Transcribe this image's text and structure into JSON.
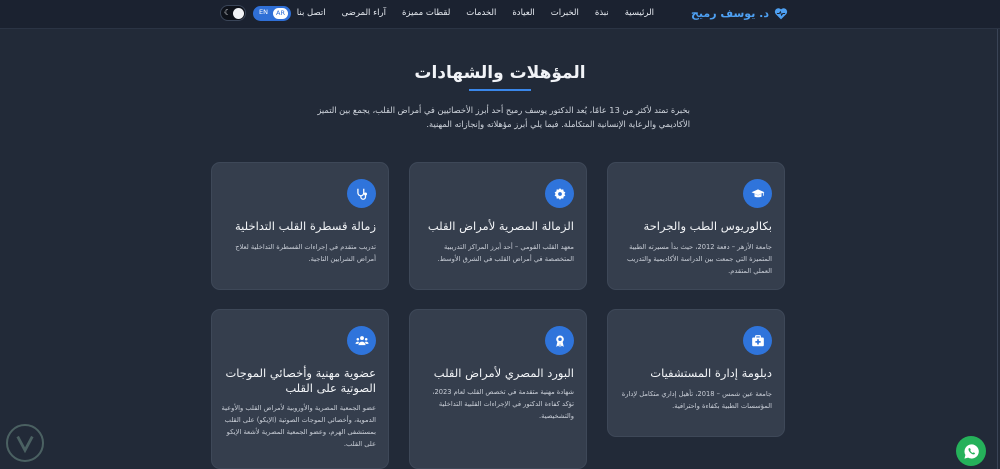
{
  "navbar": {
    "brand": "د. يوسف رميح",
    "links": [
      "الرئيسية",
      "نبذة",
      "الخبرات",
      "العيادة",
      "الخدمات",
      "لقطات مميزة",
      "آراء المرضى",
      "اتصل بنا"
    ],
    "lang_en": "EN",
    "lang_ar": "AR",
    "accent_color": "#4ea0f2"
  },
  "section": {
    "title": "المؤهلات والشهادات",
    "description": "بخبرة تمتد لأكثر من 13 عامًا، يُعد الدكتور يوسف رميح أحد أبرز الأخصائيين في أمراض القلب، يجمع بين التميز الأكاديمي والرعاية الإنسانية المتكاملة. فيما يلي أبرز مؤهلاته وإنجازاته المهنية."
  },
  "cards": [
    {
      "icon": "graduation-cap-icon",
      "title": "بكالوريوس الطب والجراحة",
      "desc": "جامعة الأزهر – دفعة 2012، حيث بدأ مسيرته الطبية المتميزة التي جمعت بين الدراسة الأكاديمية والتدريب العملي المتقدم."
    },
    {
      "icon": "badge-icon",
      "title": "الزمالة المصرية لأمراض القلب",
      "desc": "معهد القلب القومي – أحد أبرز المراكز التدريبية المتخصصة في أمراض القلب في الشرق الأوسط."
    },
    {
      "icon": "stethoscope-icon",
      "title": "زمالة قسطرة القلب التداخلية",
      "desc": "تدريب متقدم في إجراءات القسطرة التداخلية لعلاج أمراض الشرايين التاجية."
    },
    {
      "icon": "medical-kit-icon",
      "title": "دبلومة إدارة المستشفيات",
      "desc": "جامعة عين شمس – 2018، تأهيل إداري متكامل لإدارة المؤسسات الطبية بكفاءة واحترافية."
    },
    {
      "icon": "award-icon",
      "title": "البورد المصري لأمراض القلب",
      "desc": "شهادة مهنية متقدمة في تخصص القلب لعام 2023، تؤكد كفاءة الدكتور في الإجراءات القلبية التداخلية والتشخيصية."
    },
    {
      "icon": "users-icon",
      "title": "عضوية مهنية وأخصائي الموجات الصوتية على القلب",
      "desc": "عضو الجمعية المصرية والأوروبية لأمراض القلب والأوعية الدموية، وأخصائي الموجات الصوتية (الإيكو) على القلب بمستشفى الهرم، وعضو الجمعية المصرية لأشعة الإيكو على القلب."
    }
  ],
  "colors": {
    "background": "#222a38",
    "card": "#353e4d",
    "icon_circle": "#2f74db",
    "whatsapp": "#25b15a"
  }
}
